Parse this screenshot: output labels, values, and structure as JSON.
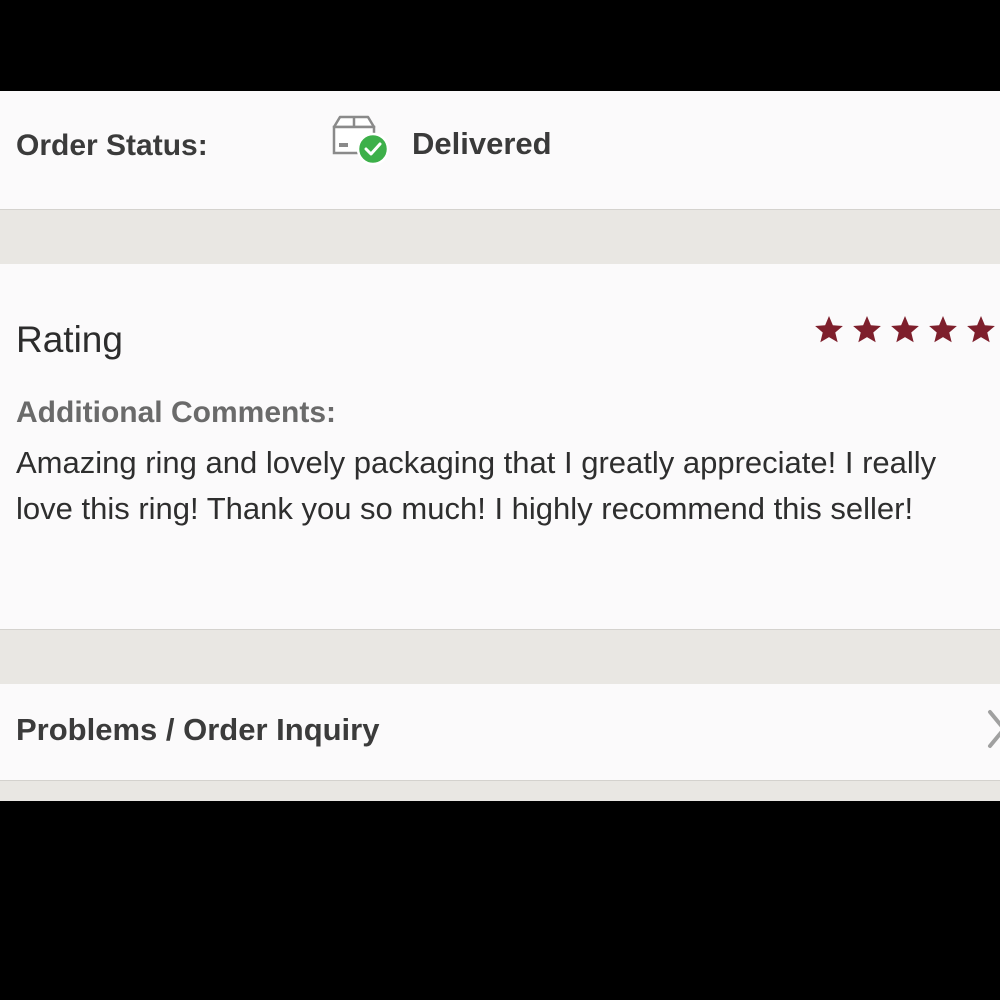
{
  "order_status": {
    "label": "Order Status:",
    "value": "Delivered",
    "icon": "package-delivered-icon",
    "check_color": "#3db04a"
  },
  "rating": {
    "title": "Rating",
    "stars": 5,
    "max_stars": 5,
    "star_color": "#7e1f2c",
    "comments_label": "Additional Comments:",
    "comment": "Amazing ring and lovely packaging that I greatly appreciate! I really love this ring! Thank you so much! I highly recommend this seller!"
  },
  "inquiry": {
    "label": "Problems / Order Inquiry",
    "icon": "chevron-right-icon"
  }
}
